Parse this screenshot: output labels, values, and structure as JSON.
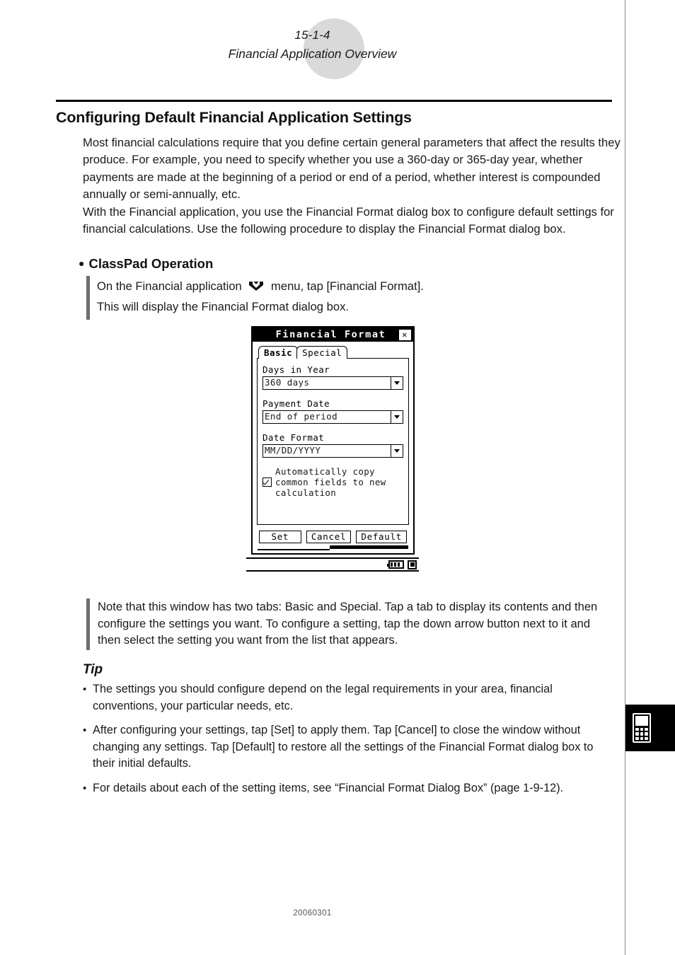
{
  "header": {
    "page_number": "15-1-4",
    "chapter_title": "Financial Application Overview"
  },
  "section": {
    "title": "Configuring Default Financial Application Settings",
    "paragraph1": "Most financial calculations require that you define certain general parameters that affect the results they produce. For example, you need to specify whether you use a 360-day or 365-day year, whether payments are made at the beginning of a period or end of a period, whether interest is compounded annually or semi-annually, etc.",
    "paragraph2": "With the Financial application, you use the Financial Format dialog box to configure default settings for financial calculations. Use the following procedure to display the Financial Format dialog box."
  },
  "operation": {
    "heading": "ClassPad Operation",
    "bullet": "●",
    "line1_before_icon": "On the Financial application",
    "menu_icon_name": "classpad-menu-icon",
    "line1_after_icon": "menu, tap [Financial Format].",
    "line2": "This will display the Financial Format dialog box."
  },
  "screenshot": {
    "dialog": {
      "title": "Financial Format",
      "close_label": "✕",
      "tabs": [
        {
          "label": "Basic",
          "active": true
        },
        {
          "label": "Special",
          "active": false
        }
      ],
      "fields": [
        {
          "label": "Days in Year",
          "value": "360 days"
        },
        {
          "label": "Payment Date",
          "value": "End of period"
        },
        {
          "label": "Date Format",
          "value": "MM/DD/YYYY"
        }
      ],
      "checkbox": {
        "checked": true,
        "line1": "Automatically copy",
        "line2": "common fields to new",
        "line3": "calculation"
      },
      "buttons": [
        {
          "label": "Set"
        },
        {
          "label": "Cancel"
        },
        {
          "label": "Default"
        }
      ]
    },
    "statusbar": {
      "battery_icon": "battery-icon",
      "square_icon": "square-indicator-icon"
    }
  },
  "note": {
    "text": "Note that this window has two tabs: Basic and Special. Tap a tab to display its contents and then configure the settings you want. To configure a setting, tap the down arrow button next to it and then select the setting you want from the list that appears."
  },
  "tip": {
    "heading": "Tip",
    "bullet": "•",
    "items": [
      "The settings you should configure depend on the legal requirements in your area, financial conventions, your particular needs, etc.",
      "After configuring your settings, tap [Set] to apply them. Tap [Cancel] to close the window without changing any settings. Tap [Default] to restore all the settings of the Financial Format dialog box to their initial defaults.",
      "For details about each of the setting items, see “Financial Format Dialog Box” (page 1-9-12)."
    ]
  },
  "edge_tab": {
    "icon_name": "classpad-device-icon"
  },
  "footer": {
    "document_code": "20060301"
  },
  "colors": {
    "header_circle": "#d9d9d9",
    "rule": "#000000",
    "quote_bar": "#6e6e6e",
    "edge_tab": "#000000"
  }
}
